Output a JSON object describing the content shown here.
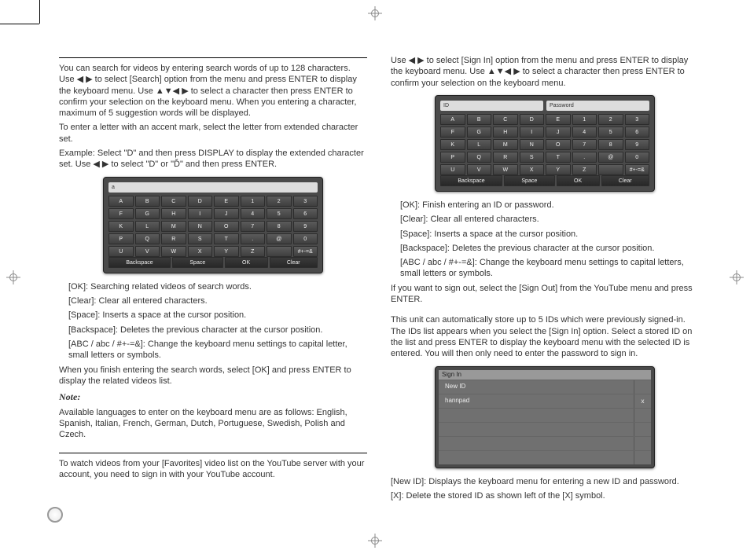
{
  "left": {
    "p1": "You can search for videos by entering search words of up to 128 characters. Use ◀ ▶ to select [Search] option from the menu and press ENTER to display the keyboard menu. Use ▲▼◀ ▶ to select a character then press ENTER to confirm your selection on the keyboard menu. When you entering a character, maximum of 5 suggestion words will be displayed.",
    "p2": "To enter a letter with an accent mark, select the letter from extended character set.",
    "p3": "Example: Select \"D\" and then press DISPLAY to display the extended character set. Use ◀ ▶ to select \"D\" or \"Ď\" and then press ENTER.",
    "k1": "[OK]: Searching related videos of search words.",
    "k2": "[Clear]: Clear all entered characters.",
    "k3": "[Space]: Inserts a space at the cursor position.",
    "k4": "[Backspace]: Deletes the previous character at the cursor position.",
    "k5": "[ABC / abc / #+-=&]: Change the keyboard menu settings to capital letter, small letters or symbols.",
    "p4": "When you finish entering the search words, select [OK] and press ENTER to display the related videos list.",
    "note_label": "Note:",
    "note": "Available languages to enter on the keyboard menu are as follows: English, Spanish, Italian, French, German, Dutch, Portuguese, Swedish, Polish and Czech.",
    "p5": "To watch videos from your [Favorites] video list on the  YouTube server with your account, you need to sign in with your  YouTube account."
  },
  "right": {
    "p1": "Use ◀ ▶ to select [Sign In] option from the menu and press ENTER to display the keyboard menu. Use ▲▼◀ ▶ to select a character then press ENTER to confirm your selection on the keyboard menu.",
    "k1": "[OK]: Finish entering an ID or password.",
    "k2": "[Clear]: Clear all entered characters.",
    "k3": "[Space]: Inserts a space at the cursor position.",
    "k4": "[Backspace]: Deletes the previous character at the cursor position.",
    "k5": "[ABC / abc / #+-=&]: Change the keyboard menu settings to capital letters, small letters or symbols.",
    "p2": "If you want to sign out, select the [Sign Out] from the  YouTube menu and press ENTER.",
    "p3": "This unit can automatically store up to 5 IDs which were previously signed-in. The IDs list appears when you select the [Sign In] option. Select a stored ID on the list and press ENTER to display the keyboard menu with the selected ID is entered.  You will then only need to enter the password to sign in.",
    "p4": "[New ID]: Displays the keyboard menu for entering a new ID and password.",
    "p5": "[X]: Delete the stored ID as shown left of the [X] symbol."
  },
  "kb1": {
    "field": "a",
    "rows": [
      [
        "A",
        "B",
        "C",
        "D",
        "E",
        "1",
        "2",
        "3"
      ],
      [
        "F",
        "G",
        "H",
        "I",
        "J",
        "4",
        "5",
        "6"
      ],
      [
        "K",
        "L",
        "M",
        "N",
        "O",
        "7",
        "8",
        "9"
      ],
      [
        "P",
        "Q",
        "R",
        "S",
        "T",
        ".",
        "@",
        "0"
      ],
      [
        "U",
        "V",
        "W",
        "X",
        "Y",
        "Z",
        "",
        "#+-=&"
      ]
    ],
    "actions": [
      "Backspace",
      "Space",
      "OK",
      "Clear"
    ]
  },
  "kb2": {
    "id_label": "ID",
    "pw_label": "Password",
    "rows": [
      [
        "A",
        "B",
        "C",
        "D",
        "E",
        "1",
        "2",
        "3"
      ],
      [
        "F",
        "G",
        "H",
        "I",
        "J",
        "4",
        "5",
        "6"
      ],
      [
        "K",
        "L",
        "M",
        "N",
        "O",
        "7",
        "8",
        "9"
      ],
      [
        "P",
        "Q",
        "R",
        "S",
        "T",
        ".",
        "@",
        "0"
      ],
      [
        "U",
        "V",
        "W",
        "X",
        "Y",
        "Z",
        "",
        "#+-=&"
      ]
    ],
    "actions": [
      "Backspace",
      "Space",
      "OK",
      "Clear"
    ]
  },
  "signin": {
    "title": "Sign In",
    "row1": "New ID",
    "row2": "hannpad",
    "x": "x"
  }
}
